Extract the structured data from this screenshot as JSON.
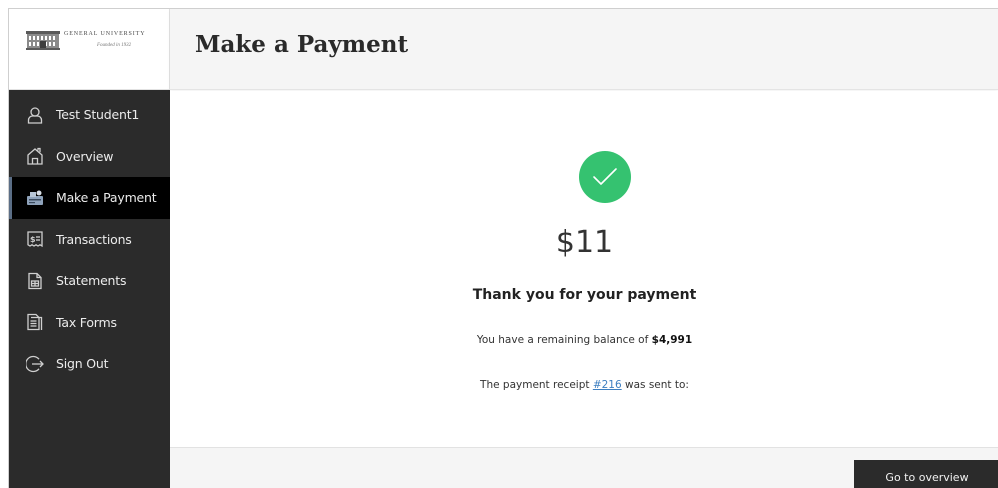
{
  "logo": {
    "name": "GENERAL UNIVERSITY",
    "subtitle": "Founded in 1932"
  },
  "sidebar": {
    "items": [
      {
        "label": "Test Student1",
        "icon": "user-icon",
        "active": false
      },
      {
        "label": "Overview",
        "icon": "home-icon",
        "active": false
      },
      {
        "label": "Make a Payment",
        "icon": "payment-icon",
        "active": true
      },
      {
        "label": "Transactions",
        "icon": "receipt-dollar-icon",
        "active": false
      },
      {
        "label": "Statements",
        "icon": "statement-document-icon",
        "active": false
      },
      {
        "label": "Tax Forms",
        "icon": "tax-form-icon",
        "active": false
      },
      {
        "label": "Sign Out",
        "icon": "sign-out-icon",
        "active": false
      }
    ]
  },
  "header": {
    "title": "Make a Payment"
  },
  "confirmation": {
    "amount": "$11",
    "thank_you": "Thank you for your payment",
    "balance_prefix": "You have a remaining balance of ",
    "balance_value": "$4,991",
    "receipt_prefix": "The payment receipt ",
    "receipt_link": "#216",
    "receipt_suffix": " was sent to:"
  },
  "footer": {
    "go_button_label": "Go to overview"
  },
  "colors": {
    "sidebar_bg": "#2b2b2b",
    "active_item_bg": "#000000",
    "success_green": "#35c270",
    "link_blue": "#3d7fc1"
  }
}
